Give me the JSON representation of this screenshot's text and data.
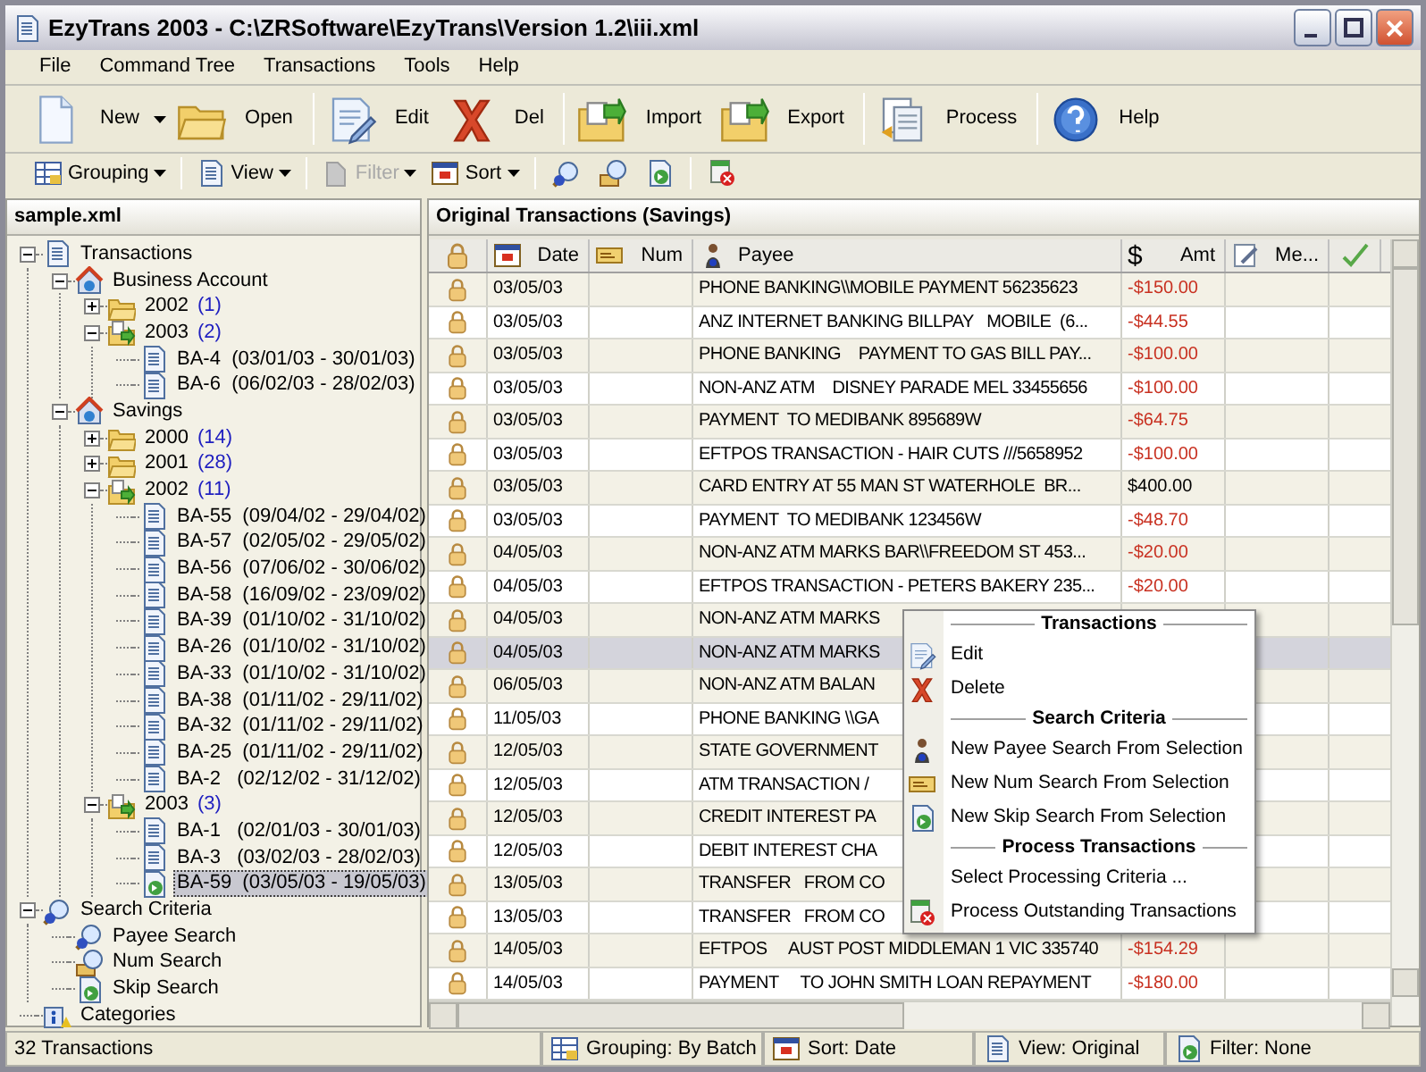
{
  "window": {
    "title": "EzyTrans 2003 - C:\\ZRSoftware\\EzyTrans\\Version 1.2\\iii.xml"
  },
  "menu": [
    "File",
    "Command Tree",
    "Transactions",
    "Tools",
    "Help"
  ],
  "toolbar": [
    [
      {
        "label": "New",
        "dropdown": true
      },
      {
        "label": "Open",
        "dropdown": false
      }
    ],
    [
      {
        "label": "Edit",
        "dropdown": false
      },
      {
        "label": "Del",
        "dropdown": false
      }
    ],
    [
      {
        "label": "Import",
        "dropdown": false
      },
      {
        "label": "Export",
        "dropdown": false
      }
    ],
    [
      {
        "label": "Process",
        "dropdown": false
      }
    ],
    [
      {
        "label": "Help",
        "dropdown": false
      }
    ]
  ],
  "toolbar2": [
    {
      "label": "Grouping",
      "disabled": false
    },
    {
      "label": "View",
      "disabled": false
    },
    {
      "label": "Filter",
      "disabled": true
    },
    {
      "label": "Sort",
      "disabled": false
    }
  ],
  "tree_panel": {
    "title": "sample.xml",
    "items": [
      {
        "label": "Transactions",
        "kind": "document",
        "expanded": true,
        "children": [
          {
            "label": "Business Account",
            "kind": "account",
            "expanded": true,
            "children": [
              {
                "label": "2002",
                "count": "(1)",
                "kind": "folder",
                "expanded": false
              },
              {
                "label": "2003",
                "count": "(2)",
                "kind": "batchfolder",
                "expanded": true,
                "children": [
                  {
                    "label": "BA-4  (03/01/03 - 30/01/03)",
                    "kind": "document",
                    "selected": false
                  },
                  {
                    "label": "BA-6  (06/02/03 - 28/02/03)",
                    "kind": "document",
                    "selected": false
                  }
                ]
              }
            ]
          },
          {
            "label": "Savings",
            "kind": "account",
            "expanded": true,
            "children": [
              {
                "label": "2000",
                "count": "(14)",
                "kind": "folder",
                "expanded": false
              },
              {
                "label": "2001",
                "count": "(28)",
                "kind": "folder",
                "expanded": false
              },
              {
                "label": "2002",
                "count": "(11)",
                "kind": "batchfolder",
                "expanded": true,
                "children": [
                  {
                    "label": "BA-55  (09/04/02 - 29/04/02)",
                    "kind": "document",
                    "selected": false
                  },
                  {
                    "label": "BA-57  (02/05/02 - 29/05/02)",
                    "kind": "document",
                    "selected": false
                  },
                  {
                    "label": "BA-56  (07/06/02 - 30/06/02)",
                    "kind": "document",
                    "selected": false
                  },
                  {
                    "label": "BA-58  (16/09/02 - 23/09/02)",
                    "kind": "document",
                    "selected": false
                  },
                  {
                    "label": "BA-39  (01/10/02 - 31/10/02)",
                    "kind": "document",
                    "selected": false
                  },
                  {
                    "label": "BA-26  (01/10/02 - 31/10/02)",
                    "kind": "document",
                    "selected": false
                  },
                  {
                    "label": "BA-33  (01/10/02 - 31/10/02)",
                    "kind": "document",
                    "selected": false
                  },
                  {
                    "label": "BA-38  (01/11/02 - 29/11/02)",
                    "kind": "document",
                    "selected": false
                  },
                  {
                    "label": "BA-32  (01/11/02 - 29/11/02)",
                    "kind": "document",
                    "selected": false
                  },
                  {
                    "label": "BA-25  (01/11/02 - 29/11/02)",
                    "kind": "document",
                    "selected": false
                  },
                  {
                    "label": "BA-2   (02/12/02 - 31/12/02)",
                    "kind": "document",
                    "selected": false
                  }
                ]
              },
              {
                "label": "2003",
                "count": "(3)",
                "kind": "batchfolder",
                "expanded": true,
                "children": [
                  {
                    "label": "BA-1   (02/01/03 - 30/01/03)",
                    "kind": "document",
                    "selected": false
                  },
                  {
                    "label": "BA-3   (03/02/03 - 28/02/03)",
                    "kind": "document",
                    "selected": false
                  },
                  {
                    "label": "BA-59  (03/05/03 - 19/05/03)",
                    "kind": "newbatch",
                    "selected": true
                  }
                ]
              }
            ]
          }
        ]
      },
      {
        "label": "Search Criteria",
        "kind": "search",
        "expanded": true,
        "children": [
          {
            "label": "Payee Search",
            "kind": "payee"
          },
          {
            "label": "Num Search",
            "kind": "num"
          },
          {
            "label": "Skip Search",
            "kind": "skip"
          }
        ]
      },
      {
        "label": "Categories",
        "kind": "categories"
      }
    ]
  },
  "grid": {
    "title": "Original Transactions (Savings)",
    "columns": [
      {},
      {
        "label": "Date"
      },
      {
        "label": "Num"
      },
      {
        "label": "Payee"
      },
      {
        "label": "Amt",
        "symbol": "$"
      },
      {
        "label": "Me..."
      },
      {}
    ],
    "rows": [
      {
        "date": "03/05/03",
        "payee": "PHONE BANKING\\\\MOBILE PAYMENT 56235623",
        "amount": "-$150.00",
        "debit": true,
        "selected": false
      },
      {
        "date": "03/05/03",
        "payee": "ANZ INTERNET BANKING BILLPAY   MOBILE  (6...",
        "amount": "-$44.55",
        "debit": true,
        "selected": false
      },
      {
        "date": "03/05/03",
        "payee": "PHONE BANKING    PAYMENT TO GAS BILL PAY...",
        "amount": "-$100.00",
        "debit": true,
        "selected": false
      },
      {
        "date": "03/05/03",
        "payee": "NON-ANZ ATM    DISNEY PARADE MEL 33455656",
        "amount": "-$100.00",
        "debit": true,
        "selected": false
      },
      {
        "date": "03/05/03",
        "payee": "PAYMENT  TO MEDIBANK 895689W",
        "amount": "-$64.75",
        "debit": true,
        "selected": false
      },
      {
        "date": "03/05/03",
        "payee": "EFTPOS TRANSACTION - HAIR CUTS ///5658952",
        "amount": "-$100.00",
        "debit": true,
        "selected": false
      },
      {
        "date": "03/05/03",
        "payee": "CARD ENTRY AT 55 MAN ST WATERHOLE  BR...",
        "amount": "$400.00",
        "debit": false,
        "selected": false
      },
      {
        "date": "03/05/03",
        "payee": "PAYMENT  TO MEDIBANK 123456W",
        "amount": "-$48.70",
        "debit": true,
        "selected": false
      },
      {
        "date": "04/05/03",
        "payee": "NON-ANZ ATM MARKS BAR\\\\FREEDOM ST 453...",
        "amount": "-$20.00",
        "debit": true,
        "selected": false
      },
      {
        "date": "04/05/03",
        "payee": "EFTPOS TRANSACTION - PETERS BAKERY 235...",
        "amount": "-$20.00",
        "debit": true,
        "selected": false
      },
      {
        "date": "04/05/03",
        "payee": "NON-ANZ ATM MARKS",
        "selected": false
      },
      {
        "date": "04/05/03",
        "payee": "NON-ANZ ATM MARKS",
        "selected": true
      },
      {
        "date": "06/05/03",
        "payee": "NON-ANZ ATM BALAN",
        "selected": false
      },
      {
        "date": "11/05/03",
        "payee": "PHONE BANKING \\\\GA",
        "selected": false
      },
      {
        "date": "12/05/03",
        "payee": "STATE GOVERNMENT",
        "selected": false
      },
      {
        "date": "12/05/03",
        "payee": "ATM TRANSACTION /",
        "selected": false
      },
      {
        "date": "12/05/03",
        "payee": "CREDIT INTEREST PA",
        "selected": false
      },
      {
        "date": "12/05/03",
        "payee": "DEBIT INTEREST CHA",
        "selected": false
      },
      {
        "date": "13/05/03",
        "payee": "TRANSFER   FROM CO",
        "selected": false
      },
      {
        "date": "13/05/03",
        "payee": "TRANSFER   FROM CO",
        "selected": false
      },
      {
        "date": "14/05/03",
        "payee": "EFTPOS     AUST POST MIDDLEMAN 1 VIC 335740",
        "amount": "-$154.29",
        "debit": true,
        "selected": false
      },
      {
        "date": "14/05/03",
        "payee": "PAYMENT     TO JOHN SMITH LOAN REPAYMENT",
        "amount": "-$180.00",
        "debit": true,
        "selected": false
      }
    ]
  },
  "context_menu": [
    {
      "title": "Transactions",
      "items": [
        "Edit",
        "Delete"
      ]
    },
    {
      "title": "Search Criteria",
      "items": [
        "New Payee Search From Selection",
        "New Num Search From Selection",
        "New Skip Search From Selection"
      ]
    },
    {
      "title": "Process Transactions",
      "items": [
        "Select Processing Criteria ...",
        "Process Outstanding Transactions"
      ]
    }
  ],
  "status_bar": [
    "32 Transactions",
    "Grouping: By Batch",
    "Sort: Date",
    "View: Original",
    "Filter: None"
  ]
}
